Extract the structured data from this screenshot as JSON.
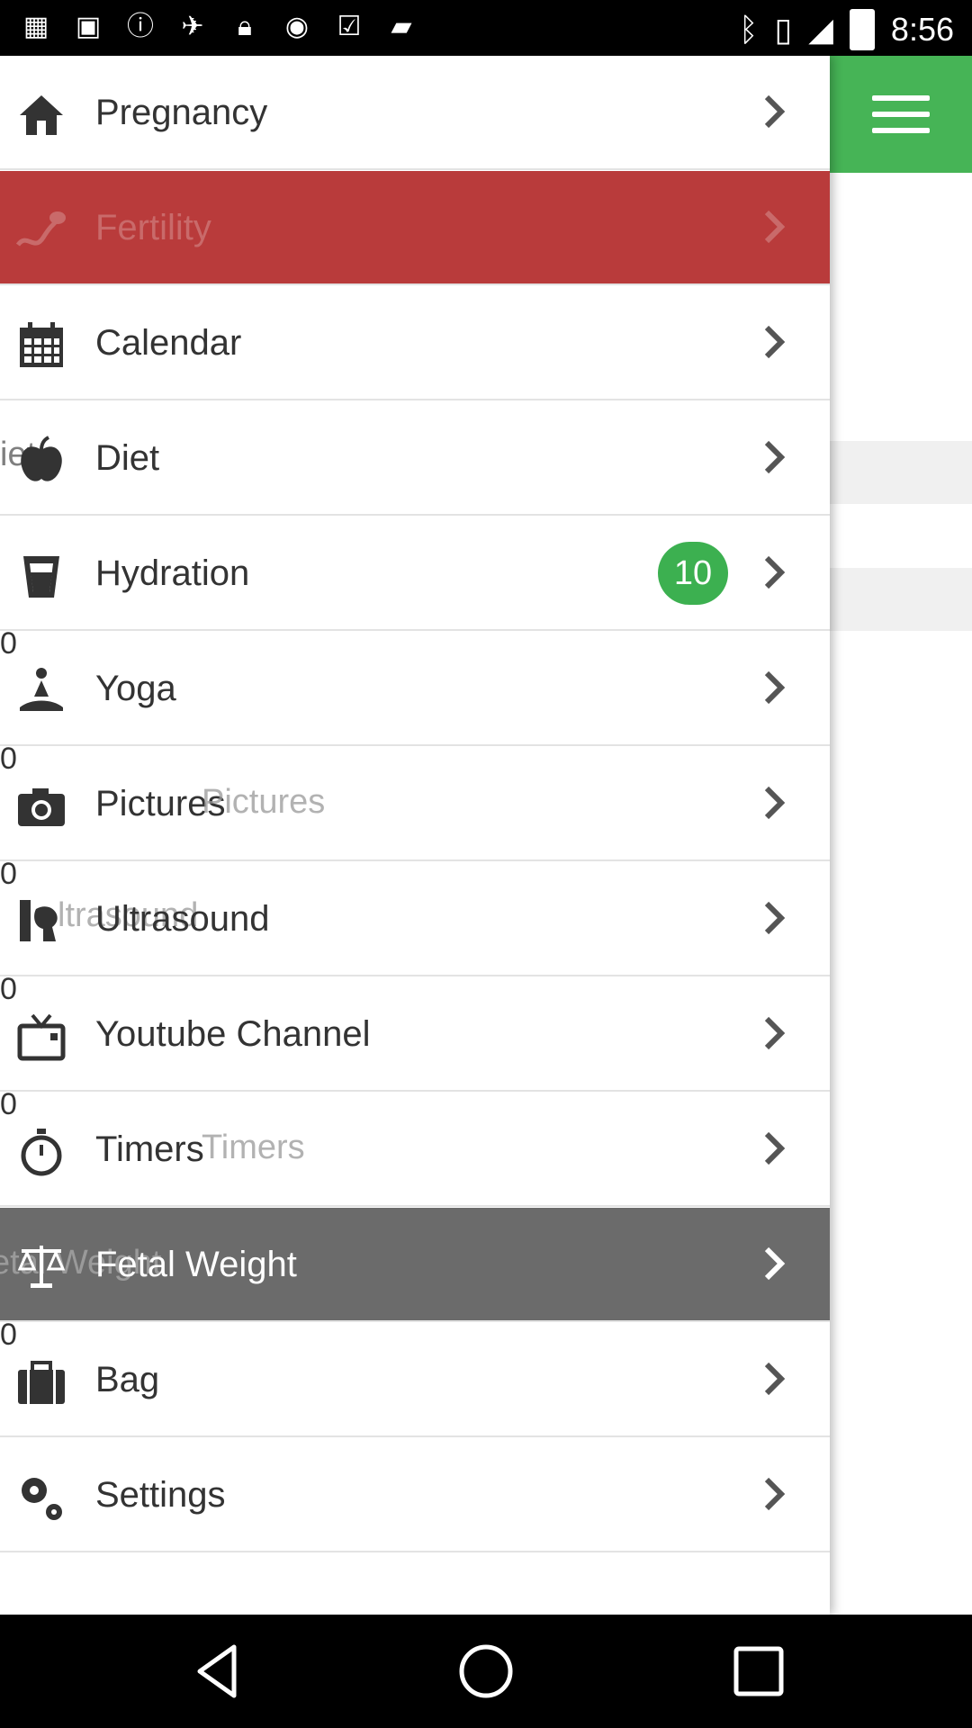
{
  "status_bar": {
    "time": "8:56",
    "left_icons": [
      "grid-icon",
      "image-icon",
      "alert-icon",
      "satellite-icon",
      "lock-icon",
      "gamepad-icon",
      "clipboard-check-icon",
      "briefcase-icon"
    ],
    "right_icons": [
      "bluetooth-icon",
      "vibrate-icon",
      "wifi-icon",
      "battery-icon"
    ]
  },
  "header": {
    "menu_color": "#46b456"
  },
  "menu": {
    "items": [
      {
        "label": "Pregnancy",
        "icon": "home-icon"
      },
      {
        "label": "Fertility",
        "icon": "sperm-icon"
      },
      {
        "label": "Calendar",
        "icon": "calendar-icon"
      },
      {
        "label": "Diet",
        "icon": "apple-icon"
      },
      {
        "label": "Hydration",
        "icon": "glass-icon",
        "badge": "10"
      },
      {
        "label": "Yoga",
        "icon": "yoga-icon"
      },
      {
        "label": "Pictures",
        "icon": "camera-icon"
      },
      {
        "label": "Ultrasound",
        "icon": "ultrasound-icon"
      },
      {
        "label": "Youtube Channel",
        "icon": "tv-icon"
      },
      {
        "label": "Timers",
        "icon": "stopwatch-icon"
      },
      {
        "label": "Fetal Weight",
        "icon": "scale-icon"
      },
      {
        "label": "Bag",
        "icon": "suitcase-icon"
      },
      {
        "label": "Settings",
        "icon": "gears-icon"
      }
    ],
    "active_color": "#b93b3b",
    "highlight_color": "#6b6b6b",
    "badge_color": "#3cb050"
  },
  "ghost_text": {
    "diet": "iet",
    "pictures": "Pictures",
    "ultrasound": "ltrasound",
    "timers": "Timers",
    "fetal": "etal Weight",
    "zero": "0"
  }
}
